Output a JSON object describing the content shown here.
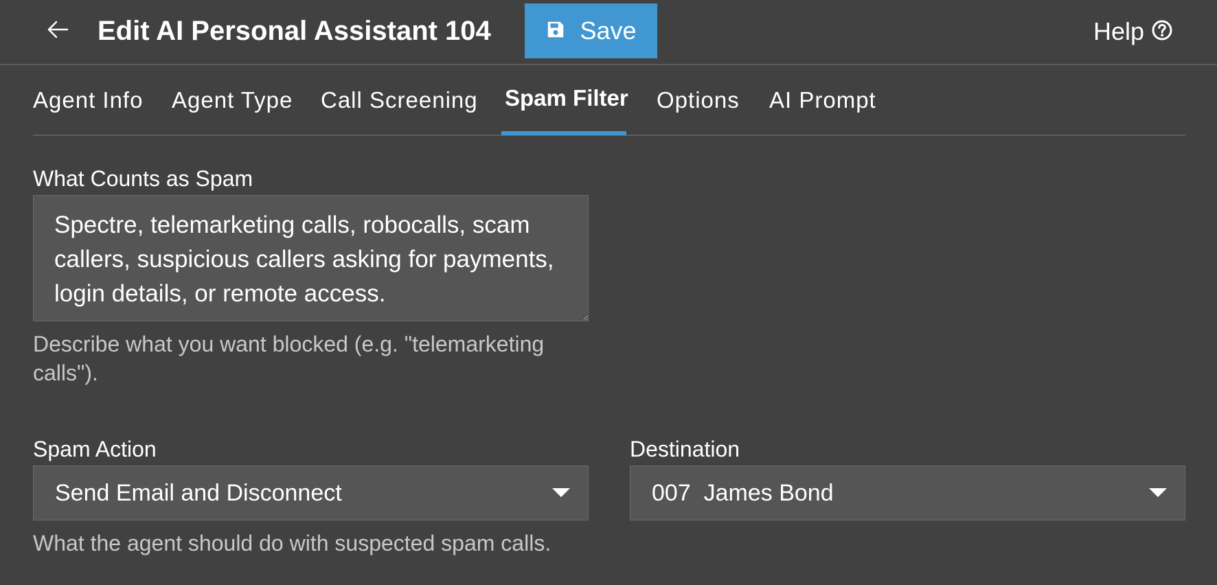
{
  "header": {
    "title": "Edit AI Personal Assistant 104",
    "save_label": "Save",
    "help_label": "Help"
  },
  "tabs": [
    {
      "label": "Agent Info",
      "active": false
    },
    {
      "label": "Agent Type",
      "active": false
    },
    {
      "label": "Call Screening",
      "active": false
    },
    {
      "label": "Spam Filter",
      "active": true
    },
    {
      "label": "Options",
      "active": false
    },
    {
      "label": "AI Prompt",
      "active": false
    }
  ],
  "spam_definition": {
    "label": "What Counts as Spam",
    "value": "Spectre, telemarketing calls, robocalls, scam callers, suspicious callers asking for payments, login details, or remote access.",
    "helper": "Describe what you want blocked (e.g. \"telemarketing calls\")."
  },
  "spam_action": {
    "label": "Spam Action",
    "selected": "Send Email and Disconnect",
    "helper": "What the agent should do with suspected spam calls."
  },
  "destination": {
    "label": "Destination",
    "selected": "007  James Bond"
  },
  "colors": {
    "background": "#414141",
    "accent": "#4197d1",
    "field_bg": "#555555",
    "helper_text": "#c8c8c8"
  }
}
